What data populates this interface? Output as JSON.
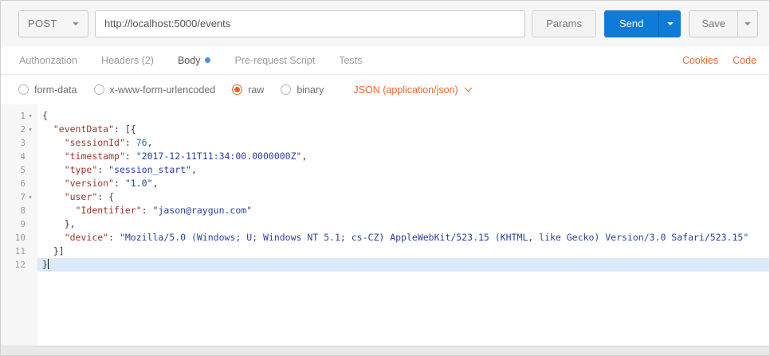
{
  "request": {
    "method": "POST",
    "url": "http://localhost:5000/events",
    "params_label": "Params",
    "send_label": "Send",
    "save_label": "Save"
  },
  "tabs": {
    "items": [
      {
        "label": "Authorization",
        "active": false,
        "dot": false
      },
      {
        "label": "Headers (2)",
        "active": false,
        "dot": false
      },
      {
        "label": "Body",
        "active": true,
        "dot": true
      },
      {
        "label": "Pre-request Script",
        "active": false,
        "dot": false
      },
      {
        "label": "Tests",
        "active": false,
        "dot": false
      }
    ],
    "cookies_label": "Cookies",
    "code_label": "Code"
  },
  "body_mode": {
    "options": [
      {
        "label": "form-data",
        "selected": false
      },
      {
        "label": "x-www-form-urlencoded",
        "selected": false
      },
      {
        "label": "raw",
        "selected": true
      },
      {
        "label": "binary",
        "selected": false
      }
    ],
    "content_type": "JSON (application/json)"
  },
  "editor": {
    "active_line": 12,
    "fold_lines": [
      1,
      2,
      7
    ],
    "lines": [
      "{",
      "  \"eventData\": [{",
      "    \"sessionId\": 76,",
      "    \"timestamp\": \"2017-12-11T11:34:00.0000000Z\",",
      "    \"type\": \"session_start\",",
      "    \"version\": \"1.0\",",
      "    \"user\": {",
      "      \"Identifier\": \"jason@raygun.com\"",
      "    },",
      "    \"device\": \"Mozilla/5.0 (Windows; U; Windows NT 5.1; cs-CZ) AppleWebKit/523.15 (KHTML, like Gecko) Version/3.0 Safari/523.15\"",
      "  }]",
      "}"
    ]
  },
  "colors": {
    "accent_orange": "#ee6730",
    "send_blue": "#0d7bd7",
    "body_dot": "#4a90e2",
    "token_key": "#a0342a",
    "token_string": "#2a3fa5",
    "token_number": "#1d6fb8",
    "active_line_bg": "#dbe9fa"
  }
}
